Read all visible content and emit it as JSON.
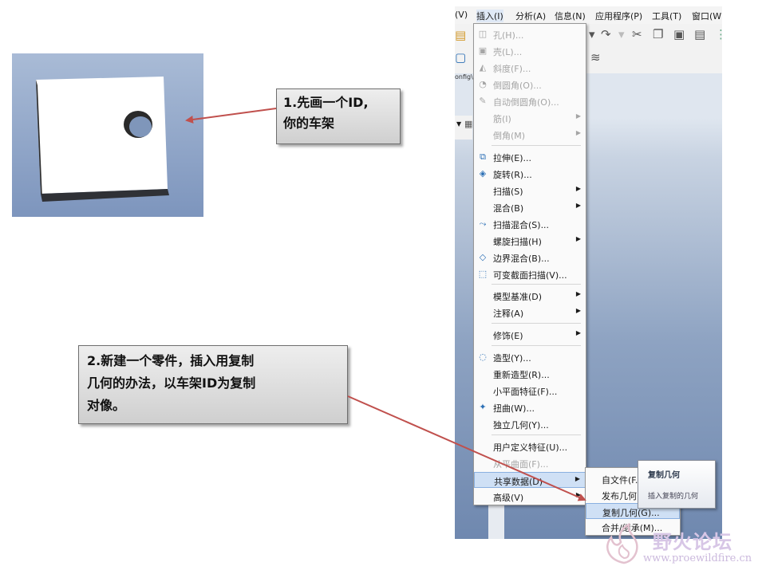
{
  "callouts": {
    "c1": "1.先画一个ID,\n你的车架",
    "c2": "2.新建一个零件，插入用复制\n几何的办法，以车架ID为复制\n对像。"
  },
  "menubar": [
    "(V)",
    "插入(I)",
    "分析(A)",
    "信息(N)",
    "应用程序(P)",
    "工具(T)",
    "窗口(W"
  ],
  "config_label": "onfig\\",
  "menu": {
    "items": [
      {
        "label": "孔(H)...",
        "icon": "hole-icon",
        "disabled": true
      },
      {
        "label": "壳(L)...",
        "icon": "shell-icon",
        "disabled": true
      },
      {
        "label": "斜度(F)...",
        "icon": "draft-icon",
        "disabled": true
      },
      {
        "label": "倒圆角(O)...",
        "icon": "round-icon",
        "disabled": true
      },
      {
        "label": "自动倒圆角(O)...",
        "icon": "auto-round-icon",
        "disabled": true
      },
      {
        "label": "筋(I)",
        "submenu": true,
        "disabled": true
      },
      {
        "label": "倒角(M)",
        "submenu": true,
        "disabled": true
      },
      {
        "label": "拉伸(E)...",
        "icon": "extrude-icon"
      },
      {
        "label": "旋转(R)...",
        "icon": "revolve-icon"
      },
      {
        "label": "扫描(S)",
        "submenu": true
      },
      {
        "label": "混合(B)",
        "submenu": true
      },
      {
        "label": "扫描混合(S)...",
        "icon": "swept-blend-icon"
      },
      {
        "label": "螺旋扫描(H)",
        "submenu": true
      },
      {
        "label": "边界混合(B)...",
        "icon": "boundary-blend-icon"
      },
      {
        "label": "可变截面扫描(V)...",
        "icon": "variable-sweep-icon"
      },
      {
        "label": "模型基准(D)",
        "submenu": true
      },
      {
        "label": "注释(A)",
        "submenu": true
      },
      {
        "label": "修饰(E)",
        "submenu": true
      },
      {
        "label": "造型(Y)...",
        "icon": "style-icon"
      },
      {
        "label": "重新造型(R)..."
      },
      {
        "label": "小平面特征(F)..."
      },
      {
        "label": "扭曲(W)...",
        "icon": "warp-icon"
      },
      {
        "label": "独立几何(Y)..."
      },
      {
        "label": "用户定义特征(U)..."
      },
      {
        "label": "从平曲面(F)...",
        "disabled": true
      },
      {
        "label": "共享数据(D)",
        "submenu": true,
        "highlighted": true
      },
      {
        "label": "高级(V)",
        "submenu": true
      }
    ]
  },
  "submenu": {
    "items": [
      {
        "label": "自文件(F..."
      },
      {
        "label": "发布几何..."
      },
      {
        "label": "复制几何(G)...",
        "highlighted": true
      },
      {
        "label": "合并/继承(M)..."
      }
    ]
  },
  "tooltip": {
    "title": "复制几何",
    "desc": "插入复制的几何"
  },
  "watermark": {
    "title": "野火论坛",
    "url": "www.proewildfire.cn"
  },
  "colors": {
    "arrow": "#c0504d",
    "highlight": "#cfe0f5"
  }
}
